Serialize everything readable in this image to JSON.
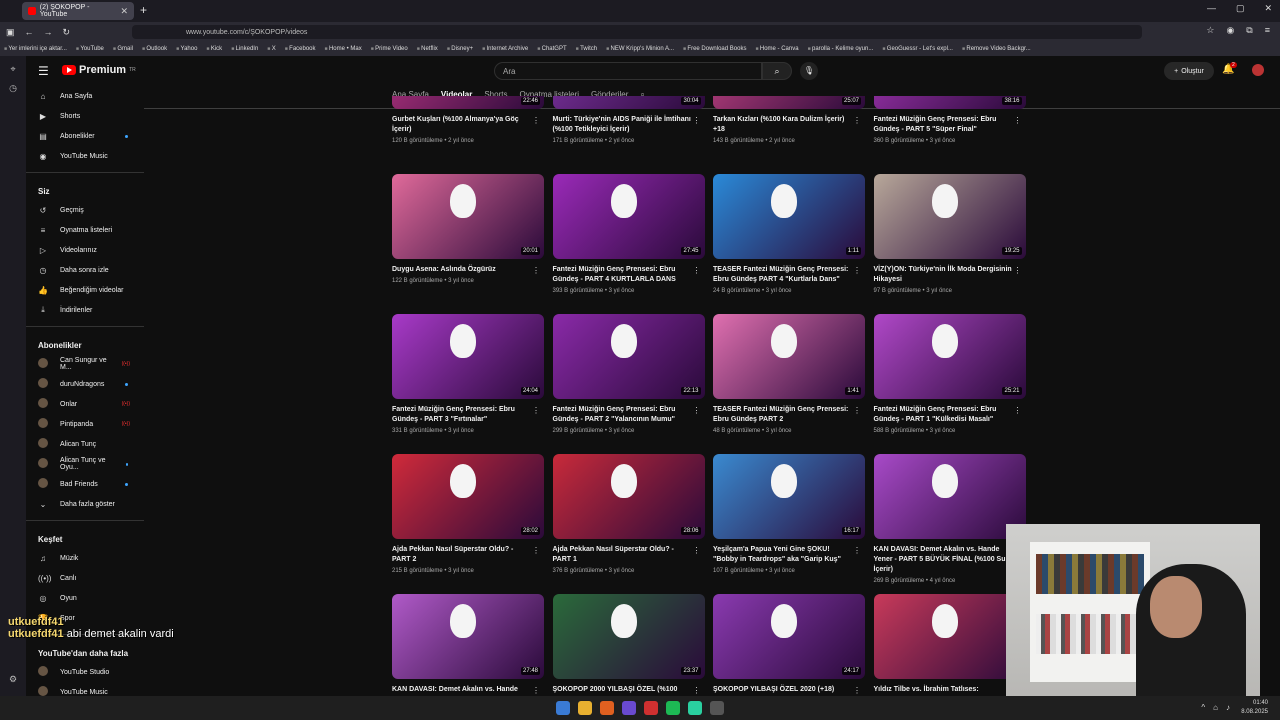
{
  "browser": {
    "tab_title": "(2) ŞOKOPOP - YouTube",
    "url": "www.youtube.com/c/ŞOKOPOP/videos",
    "bookmarks": [
      "Yer imlerini içe aktar...",
      "YouTube",
      "Gmail",
      "Outlook",
      "Yahoo",
      "Kick",
      "LinkedIn",
      "X",
      "Facebook",
      "Home • Max",
      "Prime Video",
      "Netflix",
      "Disney+",
      "Internet Archive",
      "ChatGPT",
      "Twitch",
      "NEW Kripp's Minion A...",
      "Free Download Books",
      "Home - Canva",
      "parolla - Kelime oyun...",
      "GeoGuessr - Let's expl...",
      "Remove Video Backgr..."
    ]
  },
  "header": {
    "logo": "Premium",
    "logo_sup": "TR",
    "search_placeholder": "Ara",
    "create_label": "Oluştur",
    "notif_count": "2"
  },
  "sidebar": {
    "main": [
      {
        "icon": "⌂",
        "label": "Ana Sayfa"
      },
      {
        "icon": "▶",
        "label": "Shorts"
      },
      {
        "icon": "▤",
        "label": "Abonelikler"
      },
      {
        "icon": "◉",
        "label": "YouTube Music"
      }
    ],
    "you_title": "Siz",
    "you": [
      {
        "icon": "↺",
        "label": "Geçmiş"
      },
      {
        "icon": "≡",
        "label": "Oynatma listeleri"
      },
      {
        "icon": "▷",
        "label": "Videolarınız"
      },
      {
        "icon": "◷",
        "label": "Daha sonra izle"
      },
      {
        "icon": "👍",
        "label": "Beğendiğim videolar"
      },
      {
        "icon": "⤓",
        "label": "İndirilenler"
      }
    ],
    "subs_title": "Abonelikler",
    "subs": [
      {
        "label": "Can Sungur ve M...",
        "status": "live"
      },
      {
        "label": "duruNdragons",
        "status": "dot"
      },
      {
        "label": "Onlar",
        "status": "live"
      },
      {
        "label": "Pintipanda",
        "status": "live"
      },
      {
        "label": "Alican Tunç",
        "status": ""
      },
      {
        "label": "Alican Tunç ve Oyu...",
        "status": "dot"
      },
      {
        "label": "Bad Friends",
        "status": "dot"
      }
    ],
    "show_more": "Daha fazla göster",
    "explore_title": "Keşfet",
    "explore": [
      {
        "icon": "♫",
        "label": "Müzik"
      },
      {
        "icon": "((•))",
        "label": "Canlı"
      },
      {
        "icon": "◎",
        "label": "Oyun"
      },
      {
        "icon": "🏆",
        "label": "Spor"
      }
    ],
    "more_title": "YouTube'dan daha fazla",
    "more": [
      {
        "label": "YouTube Studio"
      },
      {
        "label": "YouTube Music"
      }
    ]
  },
  "tabs": [
    "Ana Sayfa",
    "Videolar",
    "Shorts",
    "Oynatma listeleri",
    "Gönderiler"
  ],
  "active_tab": "Videolar",
  "videos": [
    {
      "title": "Gurbet Kuşları (%100 Almanya'ya Göç İçerir)",
      "meta": "120 B görüntüleme • 2 yıl önce",
      "duration": "22:46",
      "color": "#c83a8a"
    },
    {
      "title": "Murti: Türkiye'nin AIDS Paniği ile İmtihanı (%100 Tetikleyici İçerir)",
      "meta": "171 B görüntüleme • 2 yıl önce",
      "duration": "30:04",
      "color": "#8a3ab0"
    },
    {
      "title": "Tarkan Kızları (%100 Kara Dulizm İçerir) +18",
      "meta": "143 B görüntüleme • 2 yıl önce",
      "duration": "25:07",
      "color": "#d44a8a"
    },
    {
      "title": "Fantezi Müziğin Genç Prensesi: Ebru Gündeş - PART 5 \"Süper Final\"",
      "meta": "360 B görüntüleme • 3 yıl önce",
      "duration": "38:16",
      "color": "#b03ac0"
    },
    {
      "title": "Duygu Asena: Aslında Özgürüz",
      "meta": "122 B görüntüleme • 3 yıl önce",
      "duration": "20:01",
      "color": "#e06a9a"
    },
    {
      "title": "Fantezi Müziğin Genç Prensesi: Ebru Gündeş - PART 4 KURTLARLA DANS",
      "meta": "393 B görüntüleme • 3 yıl önce",
      "duration": "27:45",
      "color": "#9a2ab8"
    },
    {
      "title": "TEASER Fantezi Müziğin Genç Prensesi: Ebru Gündeş PART 4 \"Kurtlarla Dans\"",
      "meta": "24 B görüntüleme • 3 yıl önce",
      "duration": "1:11",
      "color": "#2a8ad8"
    },
    {
      "title": "VİZ(Y)ON: Türkiye'nin İlk Moda Dergisinin Hikayesi",
      "meta": "97 B görüntüleme • 3 yıl önce",
      "duration": "19:25",
      "color": "#b8a89a"
    },
    {
      "title": "Fantezi Müziğin Genç Prensesi: Ebru Gündeş - PART 3 \"Fırtınalar\"",
      "meta": "331 B görüntüleme • 3 yıl önce",
      "duration": "24:04",
      "color": "#a83ac8"
    },
    {
      "title": "Fantezi Müziğin Genç Prensesi: Ebru Gündeş - PART 2 \"Yalancının Mumu\"",
      "meta": "299 B görüntüleme • 3 yıl önce",
      "duration": "22:13",
      "color": "#8a2aa8"
    },
    {
      "title": "TEASER Fantezi Müziğin Genç Prensesi: Ebru Gündeş PART 2",
      "meta": "48 B görüntüleme • 3 yıl önce",
      "duration": "1:41",
      "color": "#e070b0"
    },
    {
      "title": "Fantezi Müziğin Genç Prensesi: Ebru Gündeş - PART 1 \"Külkedisi Masalı\"",
      "meta": "588 B görüntüleme • 3 yıl önce",
      "duration": "25:21",
      "color": "#b048c8"
    },
    {
      "title": "Ajda Pekkan Nasıl Süperstar Oldu? - PART 2",
      "meta": "215 B görüntüleme • 3 yıl önce",
      "duration": "28:02",
      "color": "#d02a3a"
    },
    {
      "title": "Ajda Pekkan Nasıl Süperstar Oldu? - PART 1",
      "meta": "376 B görüntüleme • 3 yıl önce",
      "duration": "28:06",
      "color": "#c82a3a"
    },
    {
      "title": "Yeşilçam'a Papua Yeni Gine ŞOKU! \"Bobby in Teardrops\" aka \"Garip Kuş\"",
      "meta": "107 B görüntüleme • 3 yıl önce",
      "duration": "16:17",
      "color": "#3a8ad0"
    },
    {
      "title": "KAN DAVASI: Demet Akalın vs. Hande Yener - PART 5 BÜYÜK FİNAL (%100 Sulh İçerir)",
      "meta": "269 B görüntüleme • 4 yıl önce",
      "duration": "",
      "color": "#a84ac8"
    },
    {
      "title": "KAN DAVASI: Demet Akalın vs. Hande Yener",
      "meta": "",
      "duration": "27:48",
      "color": "#b05ac8"
    },
    {
      "title": "ŞOKOPOP 2000 YILBAŞI ÖZEL (%100",
      "meta": "",
      "duration": "23:37",
      "color": "#2a6a3a"
    },
    {
      "title": "ŞOKOPOP YILBAŞI ÖZEL 2020 (+18)",
      "meta": "",
      "duration": "24:17",
      "color": "#8a3ab0"
    },
    {
      "title": "Yıldız Tilbe vs. İbrahim Tatlıses: Pezevenkl",
      "meta": "",
      "duration": "",
      "color": "#c83a5a"
    }
  ],
  "chat": [
    {
      "user": "utkuefdf41",
      "msg": ""
    },
    {
      "user": "utkuefdf41",
      "msg": "abi demet akalin vardi"
    }
  ],
  "taskbar": {
    "time": "01:40",
    "date": "8.08.2025"
  }
}
